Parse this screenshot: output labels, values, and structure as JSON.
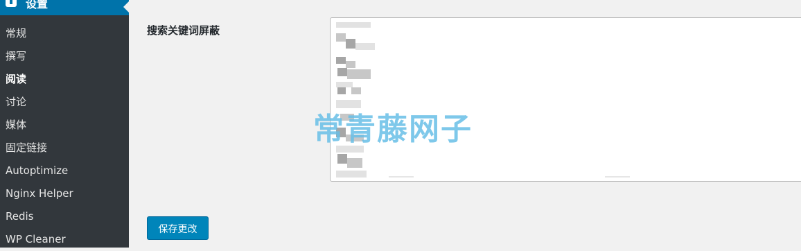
{
  "sidebar": {
    "section_title": "设置",
    "items": [
      {
        "label": "常规"
      },
      {
        "label": "撰写"
      },
      {
        "label": "阅读",
        "current": true
      },
      {
        "label": "讨论"
      },
      {
        "label": "媒体"
      },
      {
        "label": "固定链接"
      },
      {
        "label": "Autoptimize"
      },
      {
        "label": "Nginx Helper"
      },
      {
        "label": "Redis"
      },
      {
        "label": "WP Cleaner"
      }
    ]
  },
  "main": {
    "field_label": "搜索关键词屏蔽",
    "watermark": "常青藤网子",
    "save_button": "保存更改"
  },
  "colors": {
    "sidebar_bg": "#32373c",
    "accent": "#0073aa",
    "button": "#0085ba",
    "page_bg": "#f1f1f1"
  }
}
